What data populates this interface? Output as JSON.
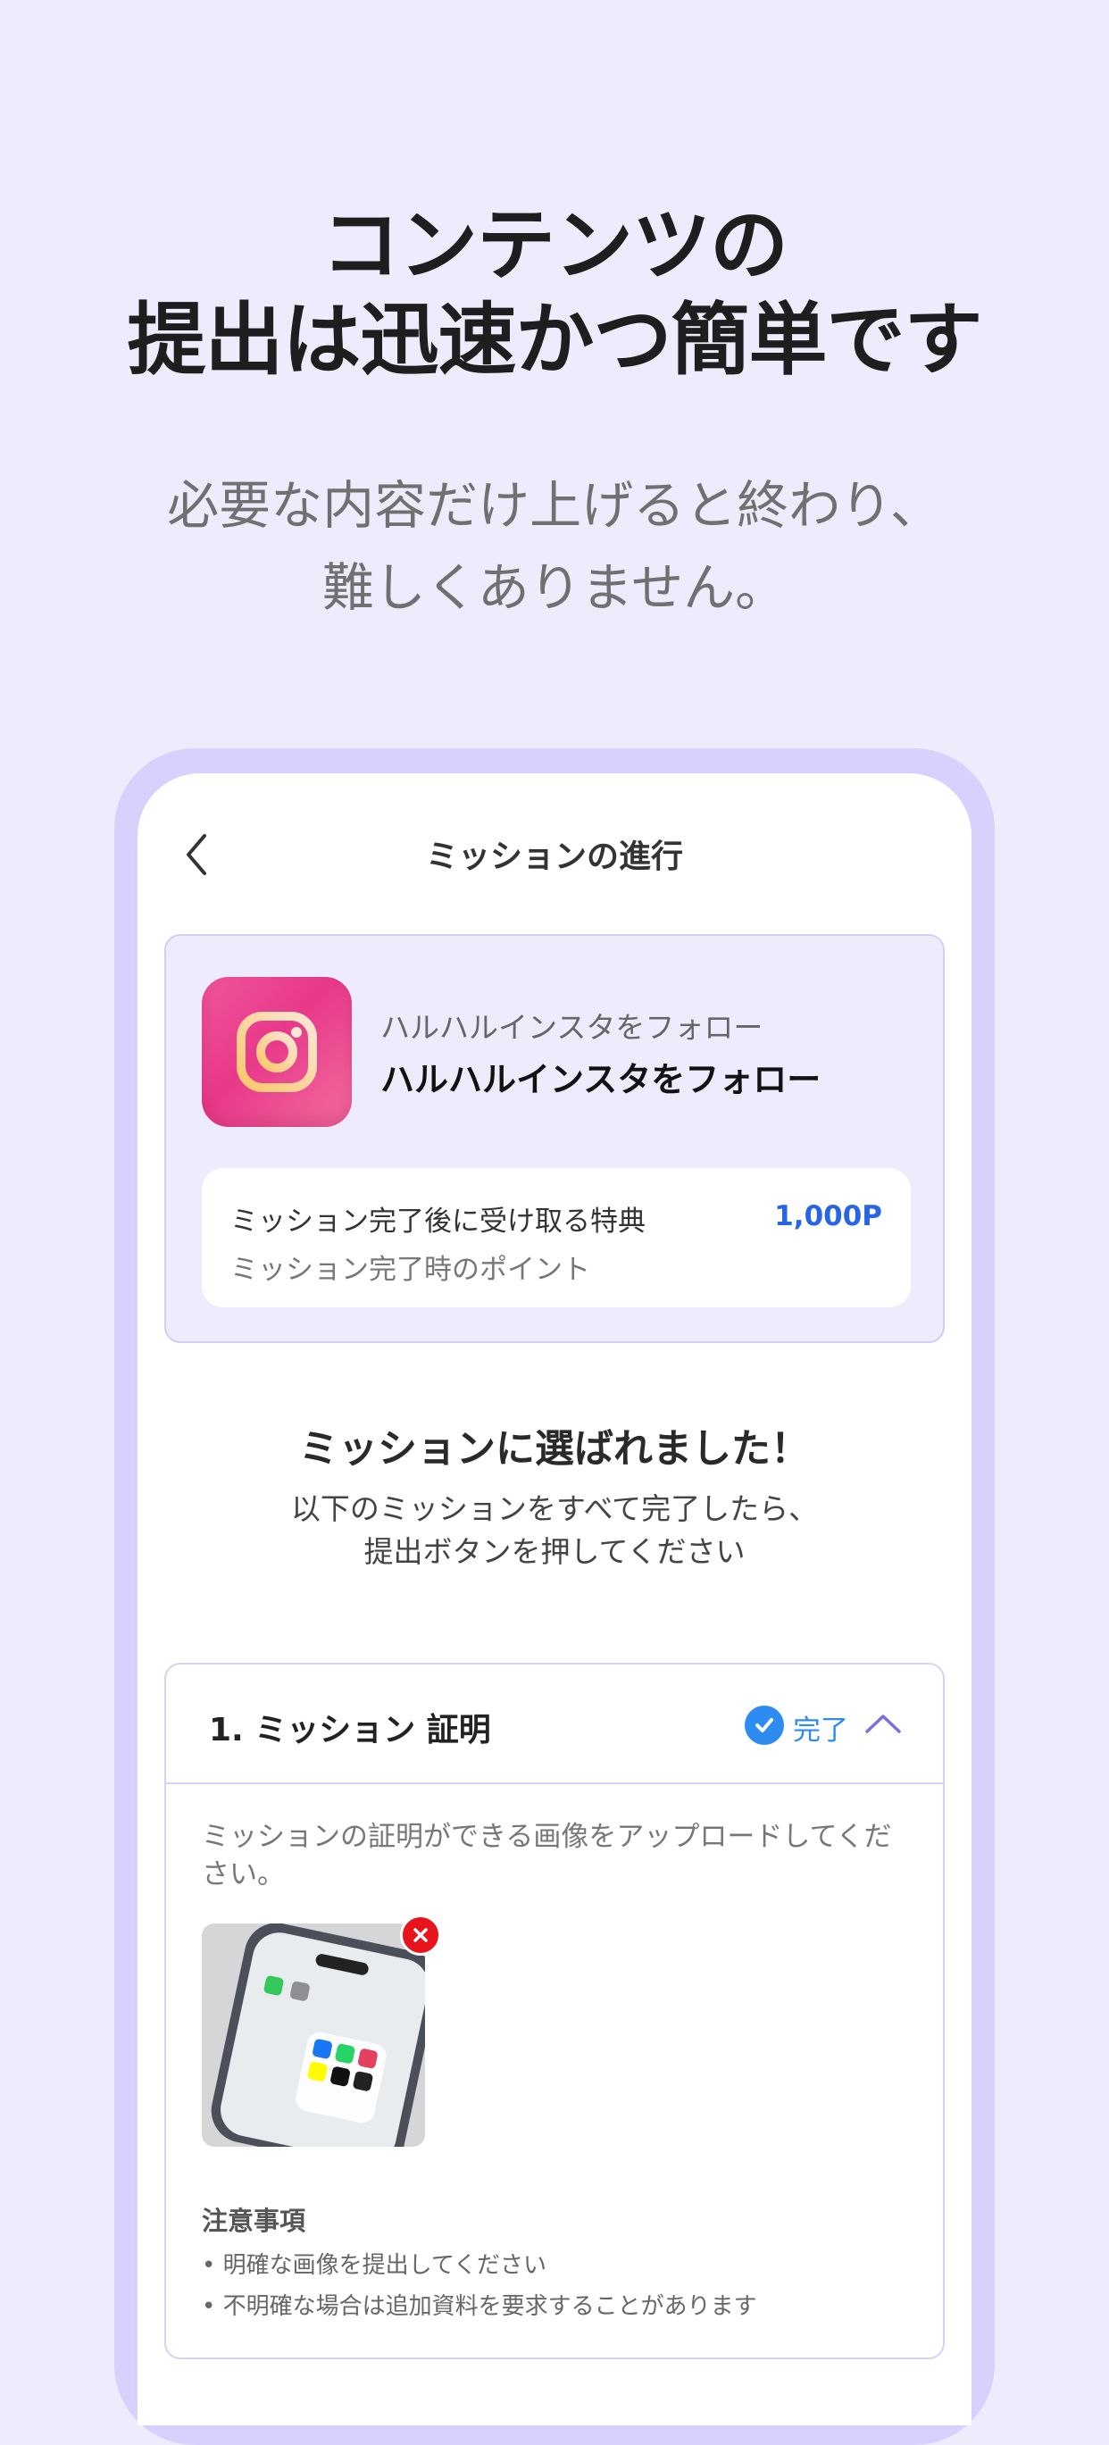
{
  "hero": {
    "title_line1": "コンテンツの",
    "title_line2": "提出は迅速かつ簡単です",
    "subtitle_line1": "必要な内容だけ上げると終わり、",
    "subtitle_line2": "難しくありません。"
  },
  "screen": {
    "nav": {
      "title": "ミッションの進行",
      "back_icon": "chevron-left-icon"
    },
    "mission": {
      "icon": "instagram-icon",
      "subtitle": "ハルハルインスタをフォロー",
      "title": "ハルハルインスタをフォロー",
      "reward": {
        "label": "ミッション完了後に受け取る特典",
        "description": "ミッション完了時のポイント",
        "value": "1,000P"
      }
    },
    "selected": {
      "title": "ミッションに選ばれました！",
      "desc_line1": "以下のミッションをすべて完了したら、",
      "desc_line2": "提出ボタンを押してください"
    },
    "step": {
      "title": "1. ミッション 証明",
      "status": "完了",
      "status_icon": "check-circle-icon",
      "toggle_icon": "chevron-up-icon",
      "upload_description": "ミッションの証明ができる画像をアップロードしてください。",
      "notice_title": "注意事項",
      "notice_items": [
        "• 明確な画像を提出してください",
        "• 不明確な場合は追加資料を要求することがあります"
      ]
    }
  },
  "colors": {
    "background": "#eeecfc",
    "frame": "#d8d1fd",
    "accent_blue": "#2765e6",
    "done_blue": "#2d8cf0",
    "remove_red": "#e8141c"
  }
}
